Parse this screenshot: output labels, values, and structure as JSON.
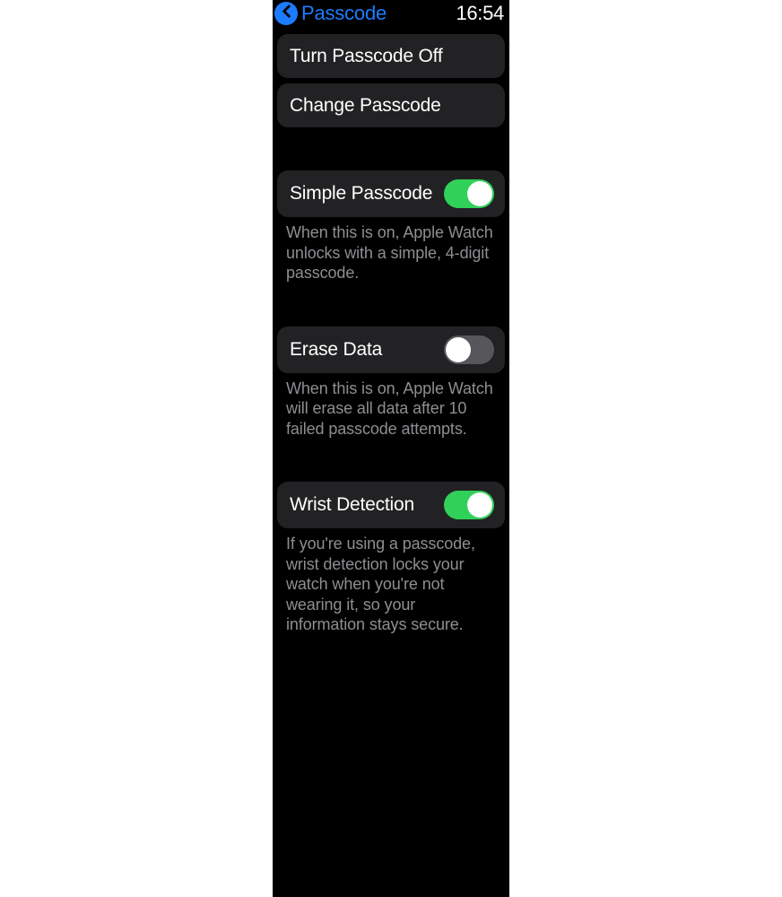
{
  "header": {
    "title": "Passcode",
    "time": "16:54"
  },
  "buttons": {
    "turn_off": "Turn Passcode Off",
    "change": "Change Passcode"
  },
  "simple": {
    "label": "Simple Passcode",
    "enabled": true,
    "description": "When this is on, Apple Watch unlocks with a simple, 4-digit passcode."
  },
  "erase": {
    "label": "Erase Data",
    "enabled": false,
    "description": "When this is on, Apple Watch will erase all data after 10 failed passcode attempts."
  },
  "wrist": {
    "label": "Wrist Detection",
    "enabled": true,
    "description": "If you're using a passcode, wrist detection locks your watch when you're not wearing it, so your information stays secure."
  }
}
